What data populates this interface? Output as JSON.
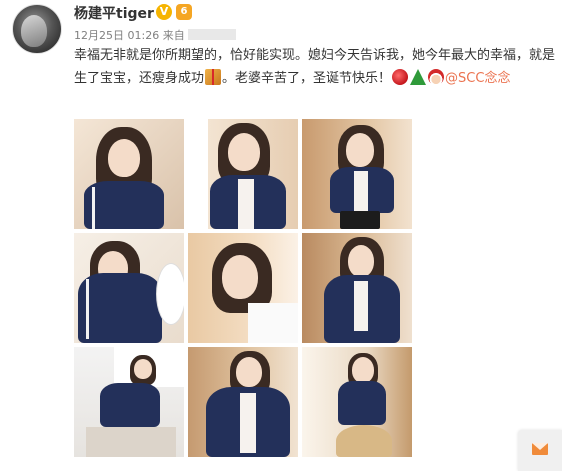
{
  "post": {
    "username": "杨建平tiger",
    "verified_icon": "v-verified-icon",
    "verified_glyph": "V",
    "level_icon": "weibo-level-icon",
    "level_glyph": "6",
    "timestamp": "12月25日 01:26",
    "source_prefix": "来自",
    "text": {
      "line1": "幸福无非就是你所期望的，恰好能实现。媳妇今天告诉我，她今年最大的幸福，",
      "line2a": "就是生了宝宝，还瘦身成功",
      "line2b": "。老婆辛苦了，圣诞节快乐！",
      "mention": "@SCC念",
      "line3": "念"
    },
    "emojis": [
      "gift-emoji",
      "apple-emoji",
      "christmas-tree-emoji",
      "santa-emoji"
    ]
  },
  "colors": {
    "mention": "#eb7350",
    "meta": "#808080",
    "jacket": "#23305a"
  },
  "photo_grid": {
    "count": 9,
    "subject": "woman in navy zip jacket with white stripes"
  },
  "mail_button": {
    "icon": "envelope-icon"
  }
}
